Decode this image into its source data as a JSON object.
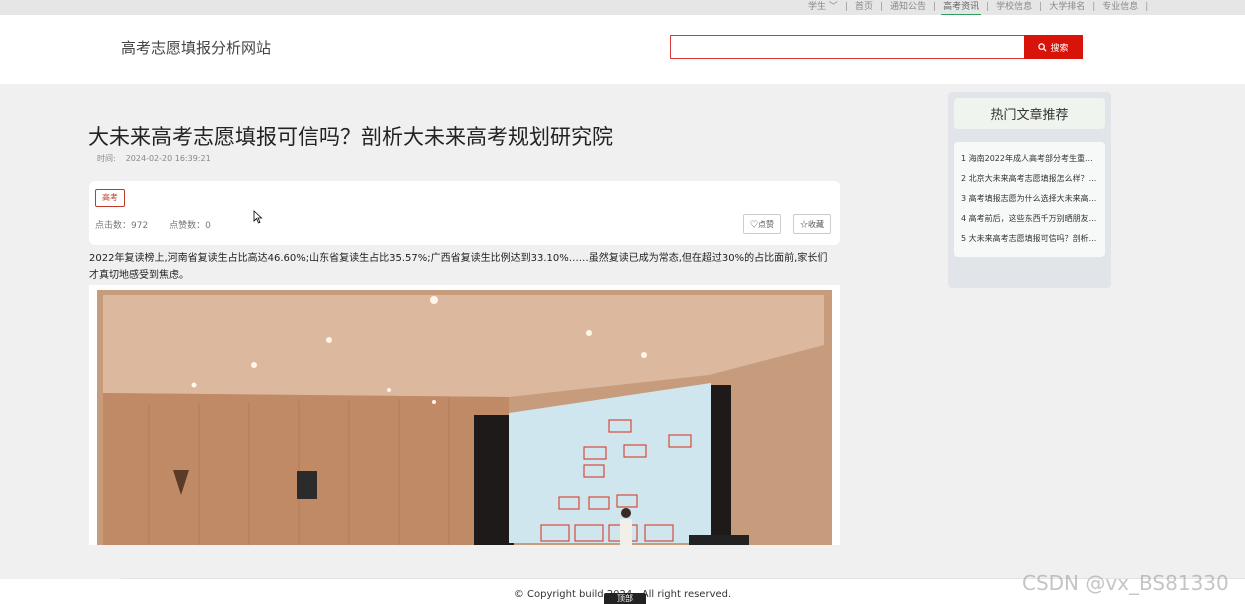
{
  "topnav": {
    "user": "学生",
    "items": [
      "首页",
      "通知公告",
      "高考资讯",
      "学校信息",
      "大学排名",
      "专业信息"
    ],
    "active_index": 2
  },
  "header": {
    "site_title": "高考志愿填报分析网站",
    "search_placeholder": "",
    "search_button": "搜索"
  },
  "article": {
    "title": "大未来高考志愿填报可信吗？剖析大未来高考规划研究院",
    "time_label": "时间:",
    "time_value": "2024-02-20 16:39:21",
    "tag": "高考",
    "clicks_label": "点击数：",
    "clicks_value": "972",
    "likes_label": "点赞数：",
    "likes_value": "0",
    "like_button": "♡点赞",
    "favorite_button": "☆收藏",
    "paragraph": "2022年复读榜上,河南省复读生占比高达46.60%;山东省复读生占比35.57%;广西省复读生比例达到33.10%……虽然复读已成为常态,但在超过30%的占比面前,家长们才真切地感受到焦虑。"
  },
  "sidebar": {
    "title": "热门文章推荐",
    "items": [
      "1 海南2022年成人高考部分考生重...",
      "2 北京大未来高考志愿填报怎么样？...",
      "3 高考填报志愿为什么选择大未来高...",
      "4 高考前后，这些东西千万别晒朋友...",
      "5 大未来高考志愿填报可信吗？剖析..."
    ]
  },
  "footer": {
    "copyright": "© Copyright build   2024 . All right reserved.",
    "top_button": "顶部"
  },
  "watermark": "CSDN @vx_BS81330",
  "colors": {
    "brand_red": "#d8140a",
    "active_green": "#2f9e5e",
    "page_bg": "#f0f0f0"
  }
}
